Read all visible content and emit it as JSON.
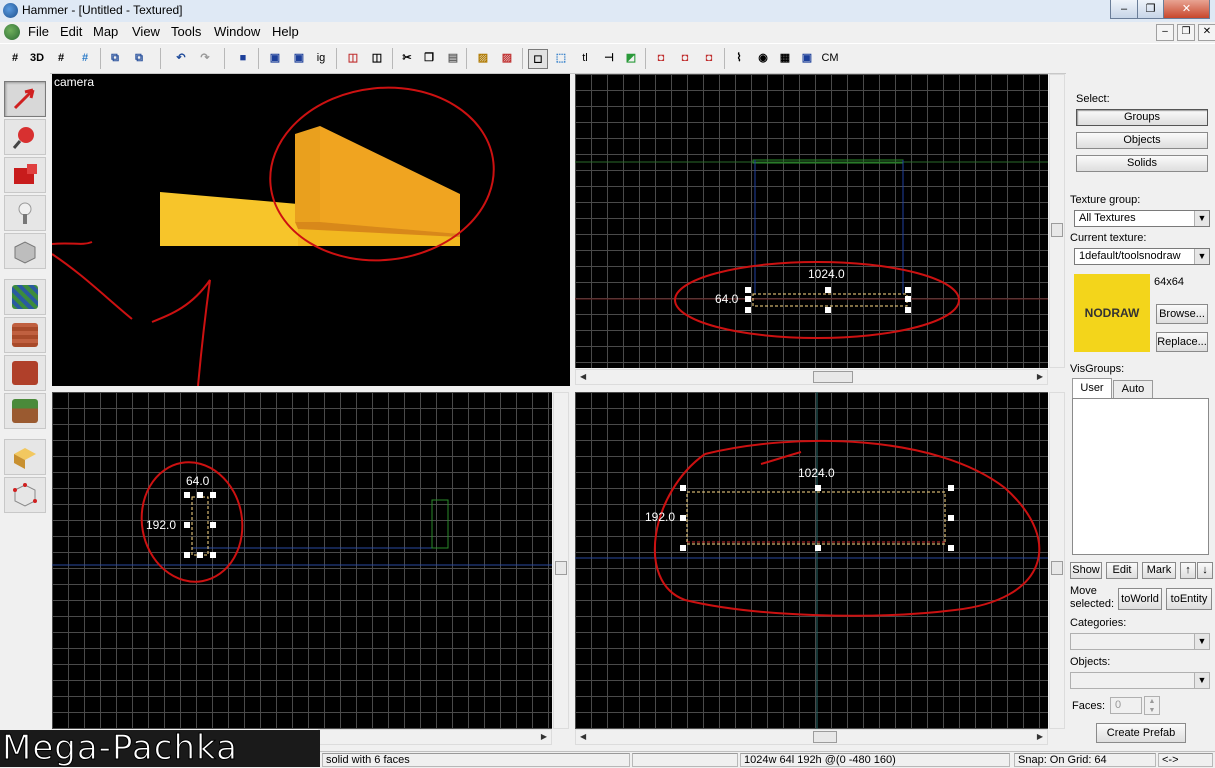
{
  "window": {
    "title": "Hammer - [Untitled - Textured]",
    "minimize": "–",
    "restore": "❐",
    "close": "✕"
  },
  "menu": [
    "File",
    "Edit",
    "Map",
    "View",
    "Tools",
    "Window",
    "Help"
  ],
  "toolbar_text": {
    "three_d": "3D",
    "ig": "ig",
    "tl": "tl",
    "cm": "CM"
  },
  "viewports": {
    "camera": {
      "label": "camera"
    },
    "top": {
      "width_label": "1024.0",
      "height_label": "64.0"
    },
    "side": {
      "top_label": "64.0",
      "left_label": "192.0"
    },
    "front": {
      "width_label": "1024.0",
      "height_label": "192.0"
    }
  },
  "panel": {
    "select_label": "Select:",
    "select_buttons": [
      "Groups",
      "Objects",
      "Solids"
    ],
    "texture_group_label": "Texture group:",
    "texture_group_value": "All Textures",
    "current_texture_label": "Current texture:",
    "current_texture_value": "1default/toolsnodraw",
    "texture_preview_text": "NODRAW",
    "texture_size": "64x64",
    "browse": "Browse...",
    "replace": "Replace...",
    "visgroups_label": "VisGroups:",
    "vis_tabs": [
      "User",
      "Auto"
    ],
    "vis_buttons": [
      "Show",
      "Edit",
      "Mark"
    ],
    "move_selected_line1": "Move",
    "move_selected_line2": "selected:",
    "to_world": "toWorld",
    "to_entity": "toEntity",
    "categories_label": "Categories:",
    "objects_label": "Objects:",
    "faces_label": "Faces:",
    "faces_value": "0",
    "create_prefab": "Create Prefab"
  },
  "status": {
    "selection": "solid with 6 faces",
    "dimensions": "1024w 64l 192h @(0 -480 160)",
    "snap": "Snap: On Grid: 64",
    "extra": "<->"
  },
  "watermark": "Mega-Pachka",
  "colors": {
    "brush": "#f5c518",
    "annotation": "#d01010",
    "nodraw": "#f3d51b"
  }
}
